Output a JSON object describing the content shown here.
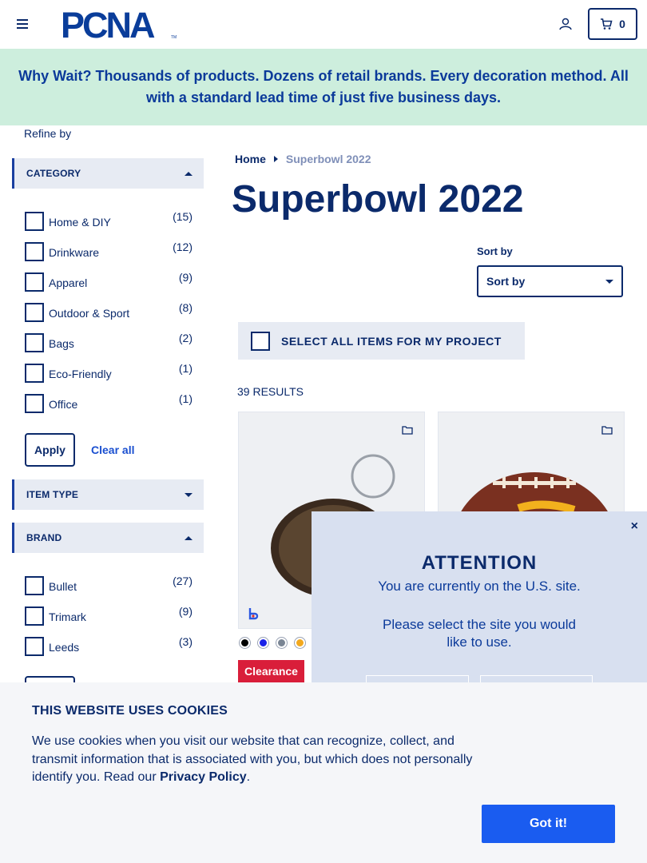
{
  "header": {
    "logo_text": "PCNA",
    "cart_count": "0"
  },
  "banner": {
    "text": "Why Wait? Thousands of products. Dozens of retail brands. Every decoration method. All with a standard lead time of just five business days."
  },
  "sidebar": {
    "refine_label": "Refine by",
    "category": {
      "title": "CATEGORY",
      "items": [
        {
          "label": "Home & DIY",
          "count": "(15)"
        },
        {
          "label": "Drinkware",
          "count": "(12)"
        },
        {
          "label": "Apparel",
          "count": "(9)"
        },
        {
          "label": "Outdoor & Sport",
          "count": "(8)"
        },
        {
          "label": "Bags",
          "count": "(2)"
        },
        {
          "label": "Eco-Friendly",
          "count": "(1)"
        },
        {
          "label": "Office",
          "count": "(1)"
        }
      ],
      "apply_label": "Apply",
      "clear_label": "Clear all"
    },
    "item_type": {
      "title": "ITEM TYPE"
    },
    "brand": {
      "title": "BRAND",
      "items": [
        {
          "label": "Bullet",
          "count": "(27)"
        },
        {
          "label": "Trimark",
          "count": "(9)"
        },
        {
          "label": "Leeds",
          "count": "(3)"
        }
      ]
    }
  },
  "main": {
    "breadcrumb": {
      "home": "Home",
      "current": "Superbowl 2022"
    },
    "title": "Superbowl 2022",
    "sort": {
      "label": "Sort by",
      "value": "Sort by"
    },
    "select_all_label": "SELECT ALL ITEMS FOR MY PROJECT",
    "results_label": "39 RESULTS",
    "product1": {
      "brand_mark": "b",
      "badge": "Clearance",
      "swatches": [
        "#000000",
        "#1a22e8",
        "#7a8594",
        "#f2a81d"
      ]
    }
  },
  "modal": {
    "close_label": "×",
    "title": "ATTENTION",
    "line1": "You are currently on the U.S. site.",
    "line2": "Please select the site you would like to use."
  },
  "cookie": {
    "title": "THIS WEBSITE USES COOKIES",
    "text_before": "We use cookies when you visit our website that can recognize, collect, and transmit information that is associated with you, but which does not personally identify you. Read our ",
    "link": "Privacy Policy",
    "text_after": ".",
    "button": "Got it!"
  },
  "colors": {
    "navy": "#0b2a6b",
    "banner_bg": "#cdeedd",
    "clearance_red": "#d91e3a",
    "cookie_button": "#1a5cf0"
  }
}
